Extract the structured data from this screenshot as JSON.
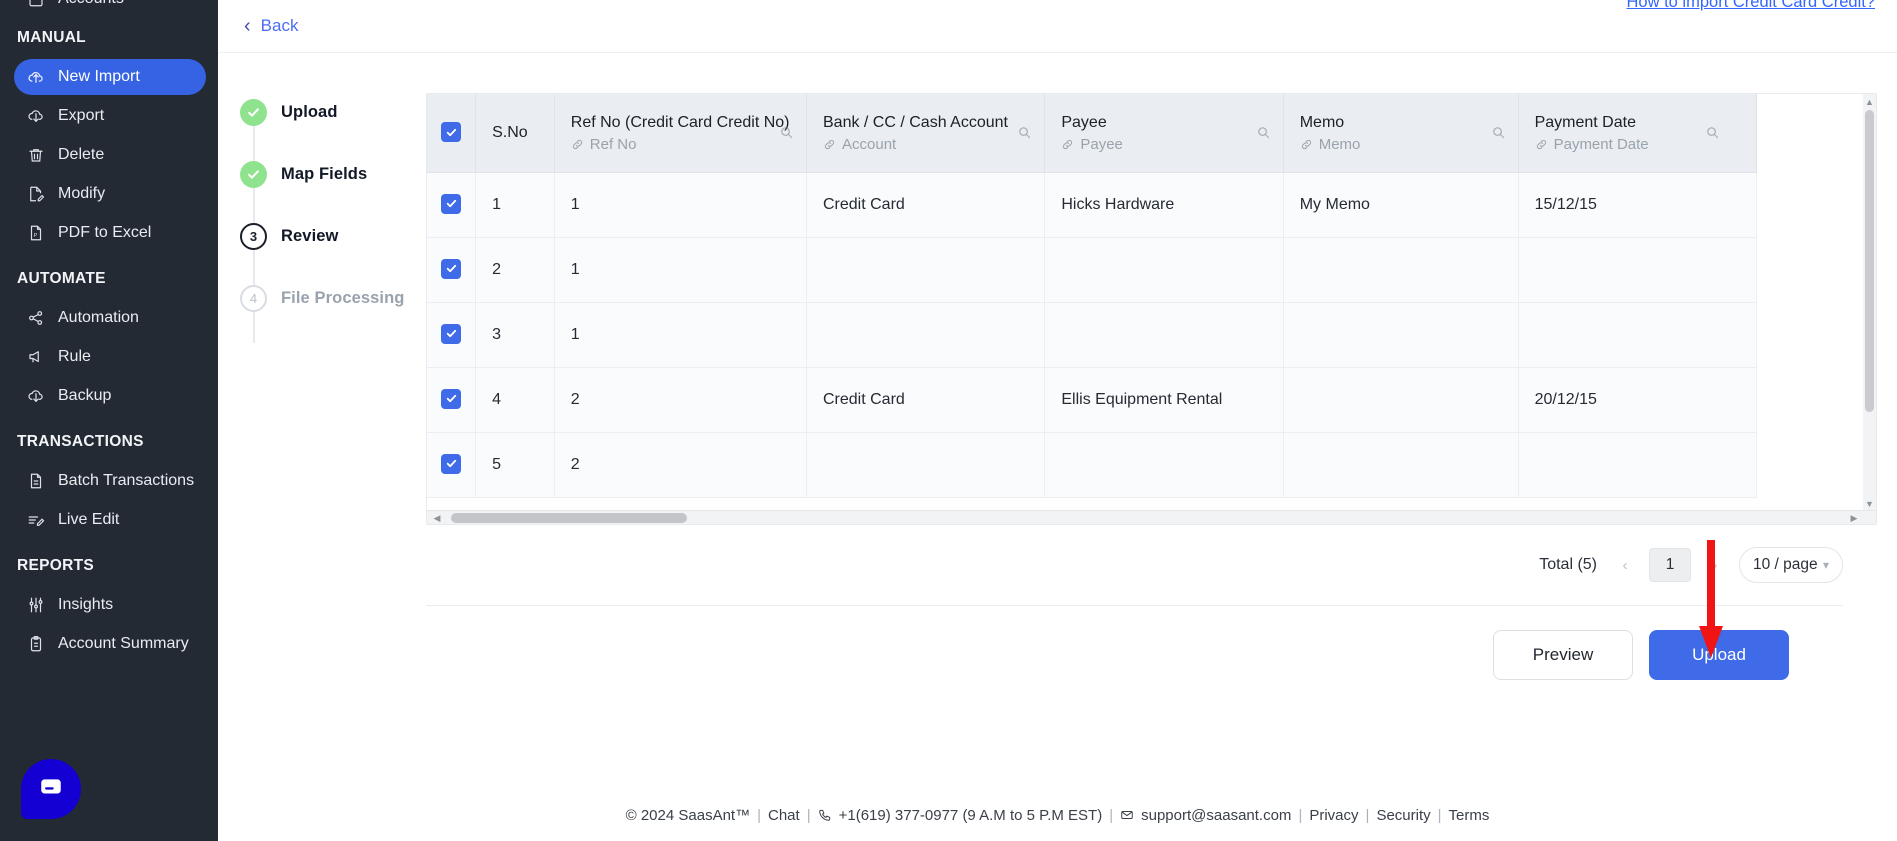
{
  "sidebar": {
    "partial_top_item": {
      "label": "Accounts",
      "icon": "accounts-icon"
    },
    "sections": [
      {
        "title": "MANUAL",
        "items": [
          {
            "label": "New Import",
            "icon": "cloud-upload-icon",
            "active": true
          },
          {
            "label": "Export",
            "icon": "cloud-download-icon",
            "active": false
          },
          {
            "label": "Delete",
            "icon": "trash-icon",
            "active": false
          },
          {
            "label": "Modify",
            "icon": "file-edit-icon",
            "active": false
          },
          {
            "label": "PDF to Excel",
            "icon": "pdf-file-icon",
            "active": false
          }
        ]
      },
      {
        "title": "AUTOMATE",
        "items": [
          {
            "label": "Automation",
            "icon": "share-nodes-icon",
            "active": false
          },
          {
            "label": "Rule",
            "icon": "megaphone-icon",
            "active": false
          },
          {
            "label": "Backup",
            "icon": "cloud-download-icon",
            "active": false
          }
        ]
      },
      {
        "title": "TRANSACTIONS",
        "items": [
          {
            "label": "Batch Transactions",
            "icon": "document-icon",
            "active": false
          },
          {
            "label": "Live Edit",
            "icon": "edit-lines-icon",
            "active": false
          }
        ]
      },
      {
        "title": "REPORTS",
        "items": [
          {
            "label": "Insights",
            "icon": "sliders-icon",
            "active": false
          },
          {
            "label": "Account Summary",
            "icon": "clipboard-icon",
            "active": false
          }
        ]
      }
    ],
    "chat_widget": {
      "icon": "chat-bubble-icon",
      "color": "#1400d2"
    }
  },
  "header": {
    "help_link": "How to import Credit Card Credit?",
    "back_label": "Back",
    "back_icon": "chevron-left-icon"
  },
  "stepper": {
    "steps": [
      {
        "label": "Upload",
        "marker": "check",
        "state": "done"
      },
      {
        "label": "Map Fields",
        "marker": "check",
        "state": "done"
      },
      {
        "label": "Review",
        "marker": "3",
        "state": "current"
      },
      {
        "label": "File Processing",
        "marker": "4",
        "state": "todo"
      }
    ]
  },
  "table": {
    "select_all_checked": true,
    "columns": [
      {
        "key": "checkbox",
        "title": "",
        "mapped": "",
        "searchable": false
      },
      {
        "key": "sno",
        "title": "S.No",
        "mapped": "",
        "searchable": false
      },
      {
        "key": "ref",
        "title": "Ref No (Credit Card Credit No)",
        "mapped": "Ref No",
        "searchable": true
      },
      {
        "key": "bank",
        "title": "Bank / CC / Cash Account",
        "mapped": "Account",
        "searchable": true
      },
      {
        "key": "payee",
        "title": "Payee",
        "mapped": "Payee",
        "searchable": true
      },
      {
        "key": "memo",
        "title": "Memo",
        "mapped": "Memo",
        "searchable": true
      },
      {
        "key": "date",
        "title": "Payment Date",
        "mapped": "Payment Date",
        "searchable": true
      }
    ],
    "rows": [
      {
        "checked": true,
        "sno": "1",
        "ref": "1",
        "bank": "Credit Card",
        "payee": "Hicks Hardware",
        "memo": "My Memo",
        "date": "15/12/15"
      },
      {
        "checked": true,
        "sno": "2",
        "ref": "1",
        "bank": "",
        "payee": "",
        "memo": "",
        "date": ""
      },
      {
        "checked": true,
        "sno": "3",
        "ref": "1",
        "bank": "",
        "payee": "",
        "memo": "",
        "date": ""
      },
      {
        "checked": true,
        "sno": "4",
        "ref": "2",
        "bank": "Credit Card",
        "payee": "Ellis Equipment Rental",
        "memo": "",
        "date": "20/12/15"
      },
      {
        "checked": true,
        "sno": "5",
        "ref": "2",
        "bank": "",
        "payee": "",
        "memo": "",
        "date": ""
      }
    ]
  },
  "pagination": {
    "total_label": "Total (5)",
    "prev_icon": "chevron-left-icon",
    "next_icon": "chevron-right-icon",
    "current_page": "1",
    "page_size": "10 / page",
    "page_size_caret": "chevron-down-icon"
  },
  "actions": {
    "preview_label": "Preview",
    "upload_label": "Upload",
    "upload_color": "#3f6ae8"
  },
  "footer": {
    "copyright": "© 2024 SaasAnt™",
    "chat": "Chat",
    "phone_icon": "phone-icon",
    "phone": "+1(619) 377-0977 (9 A.M to 5 P.M EST)",
    "mail_icon": "envelope-icon",
    "email": "support@saasant.com",
    "privacy": "Privacy",
    "security": "Security",
    "terms": "Terms",
    "separator": "|"
  },
  "annotation": {
    "arrow_color": "#f01414",
    "points_to": "page-size-selector"
  }
}
